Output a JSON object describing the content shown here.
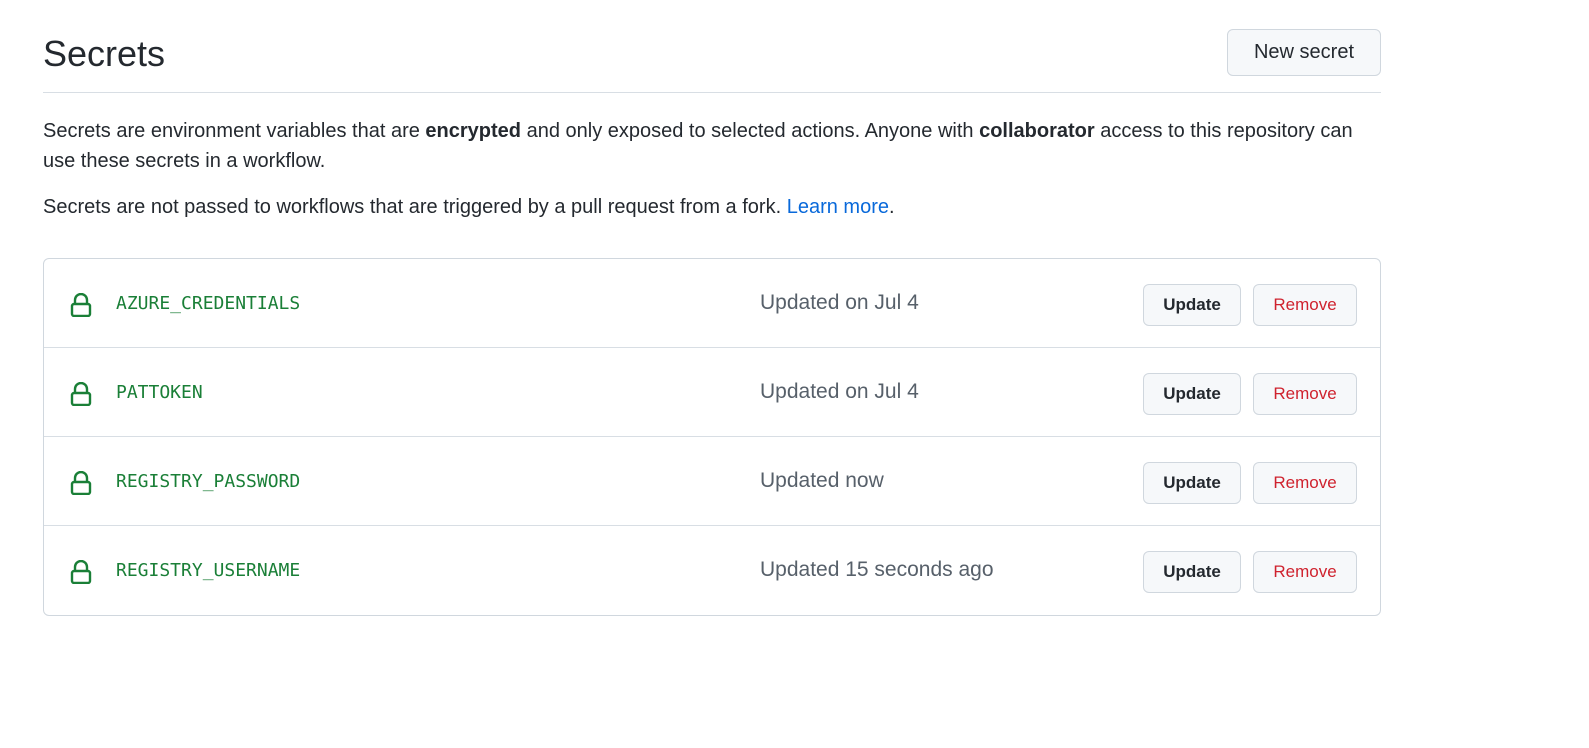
{
  "page": {
    "title": "Secrets",
    "new_secret_label": "New secret"
  },
  "description": {
    "part1": "Secrets are environment variables that are ",
    "bold1": "encrypted",
    "part2": " and only exposed to selected actions. Anyone with ",
    "bold2": "collaborator",
    "part3": " access to this repository can use these secrets in a workflow."
  },
  "fork_note": {
    "text": "Secrets are not passed to workflows that are triggered by a pull request from a fork. ",
    "link_text": "Learn more",
    "suffix": "."
  },
  "secrets": [
    {
      "name": "AZURE_CREDENTIALS",
      "updated": "Updated on Jul 4",
      "update_label": "Update",
      "remove_label": "Remove",
      "icon": "lock-icon"
    },
    {
      "name": "PATTOKEN",
      "updated": "Updated on Jul 4",
      "update_label": "Update",
      "remove_label": "Remove",
      "icon": "lock-icon"
    },
    {
      "name": "REGISTRY_PASSWORD",
      "updated": "Updated now",
      "update_label": "Update",
      "remove_label": "Remove",
      "icon": "lock-icon"
    },
    {
      "name": "REGISTRY_USERNAME",
      "updated": "Updated 15 seconds ago",
      "update_label": "Update",
      "remove_label": "Remove",
      "icon": "lock-icon"
    }
  ],
  "colors": {
    "secret_name": "#1a7f37",
    "link": "#0969da",
    "remove": "#cf222e",
    "muted": "#57606a"
  }
}
